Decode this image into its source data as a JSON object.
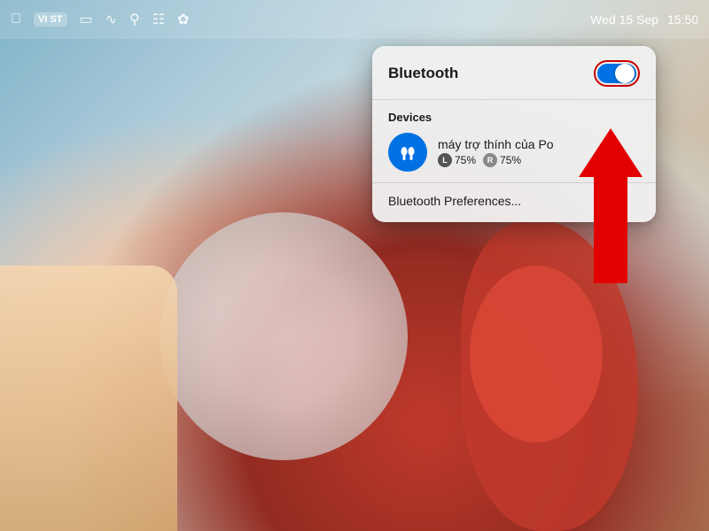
{
  "menubar": {
    "lang": "VI\nST",
    "date": "Wed 15 Sep",
    "time": "15:50"
  },
  "popup": {
    "title": "Bluetooth",
    "toggle_state": "on",
    "devices_label": "Devices",
    "device": {
      "name": "máy trợ thính của Po",
      "battery_l_label": "L",
      "battery_l_value": "75%",
      "battery_r_label": "R",
      "battery_r_value": "75%"
    },
    "preferences_link": "Bluetooth Preferences..."
  }
}
